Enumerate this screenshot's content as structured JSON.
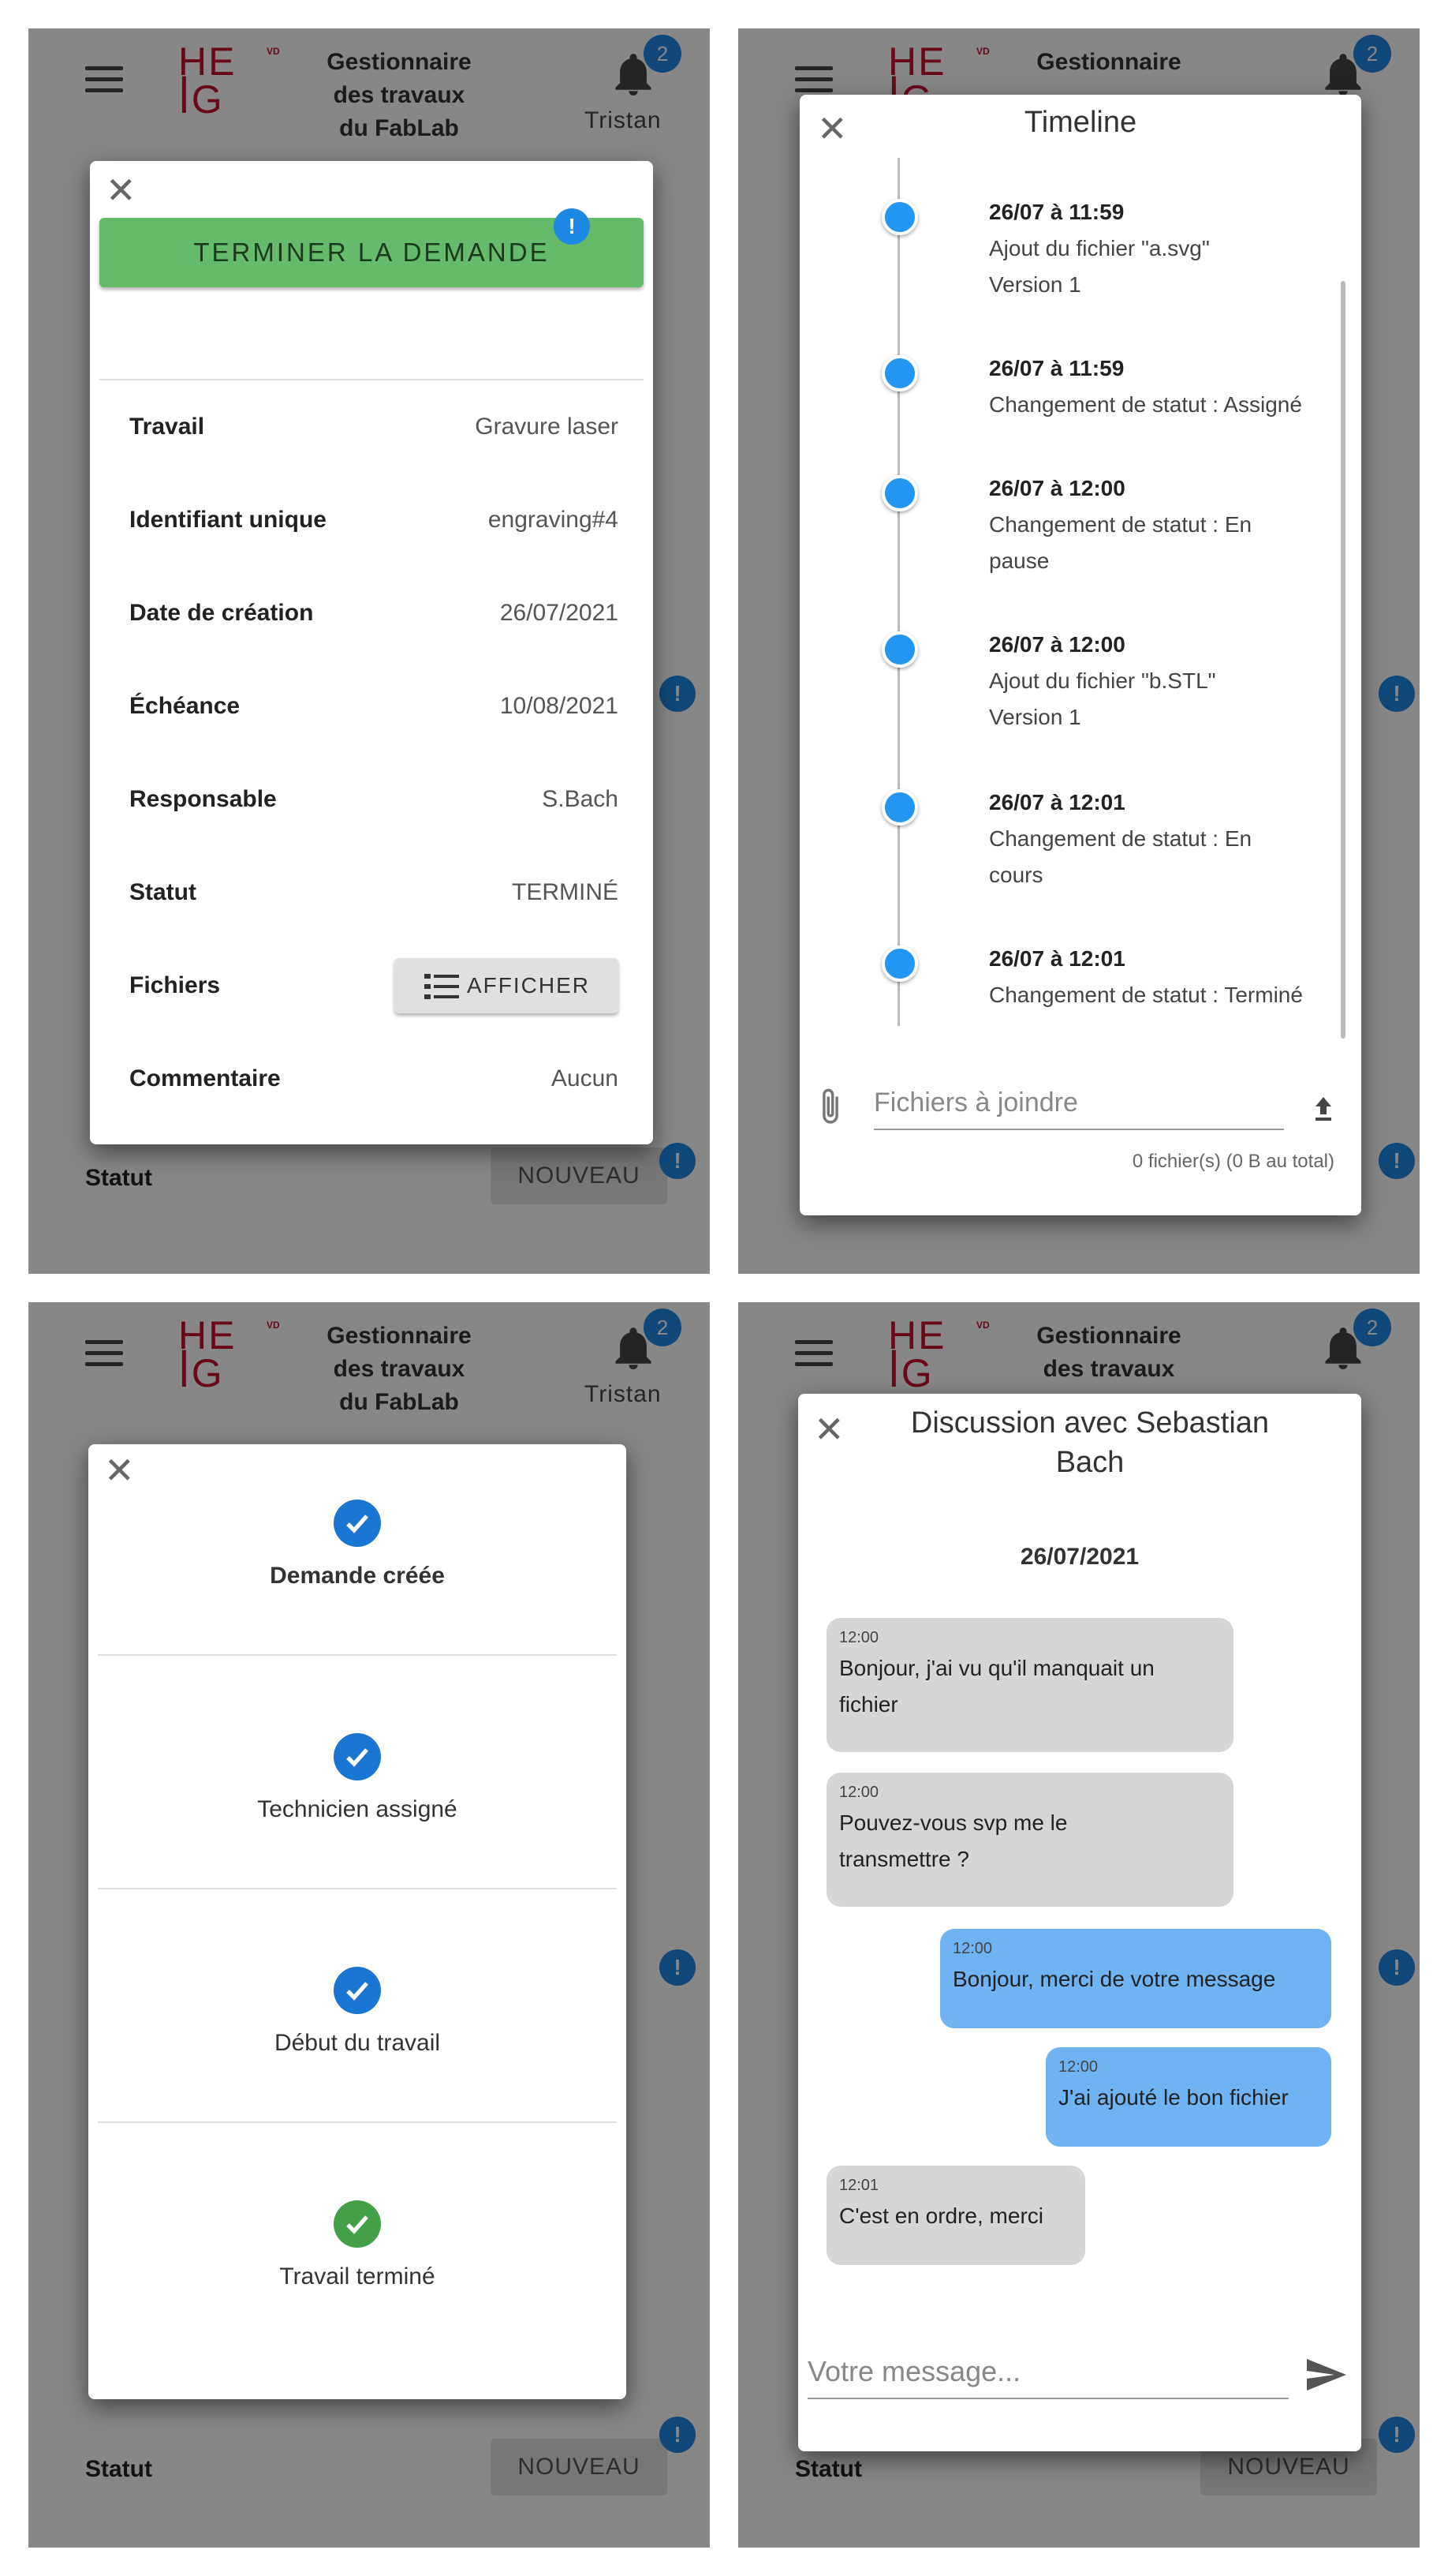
{
  "app": {
    "logo_text": "HE\nIG",
    "logo_suffix": "VD",
    "title": "Gestionnaire des travaux du FabLab",
    "title_lines": [
      "Gestionnaire",
      "des travaux",
      "du FabLab"
    ],
    "notification_count": "2",
    "user": "Tristan",
    "brand_color": "#c8102e",
    "accent_color": "#1e88e5"
  },
  "background_list": {
    "statut_label": "Statut",
    "statut_value": "NOUVEAU"
  },
  "panel_details": {
    "action_button": "TERMINER LA DEMANDE",
    "action_color": "#66bb6a",
    "rows": [
      {
        "label": "Travail",
        "value": "Gravure laser"
      },
      {
        "label": "Identifiant unique",
        "value": "engraving#4"
      },
      {
        "label": "Date de création",
        "value": "26/07/2021"
      },
      {
        "label": "Échéance",
        "value": "10/08/2021"
      },
      {
        "label": "Responsable",
        "value": "S.Bach"
      },
      {
        "label": "Statut",
        "value": "TERMINÉ"
      },
      {
        "label": "Fichiers",
        "value": "AFFICHER"
      },
      {
        "label": "Commentaire",
        "value": "Aucun"
      }
    ]
  },
  "panel_timeline": {
    "title": "Timeline",
    "events": [
      {
        "date": "26/07 à 11:59",
        "lines": [
          "Ajout du fichier \"a.svg\"",
          "Version 1"
        ]
      },
      {
        "date": "26/07 à 11:59",
        "lines": [
          "Changement de statut : Assigné"
        ]
      },
      {
        "date": "26/07 à 12:00",
        "lines": [
          "Changement de statut : En",
          "pause"
        ]
      },
      {
        "date": "26/07 à 12:00",
        "lines": [
          "Ajout du fichier \"b.STL\"",
          "Version 1"
        ]
      },
      {
        "date": "26/07 à 12:01",
        "lines": [
          "Changement de statut : En",
          "cours"
        ]
      },
      {
        "date": "26/07 à 12:01",
        "lines": [
          "Changement de statut : Terminé"
        ]
      }
    ],
    "file_input_placeholder": "Fichiers à joindre",
    "file_count": "0 fichier(s) (0 B au total)"
  },
  "panel_steps": {
    "steps": [
      {
        "label": "Demande créée",
        "icon": "check-circle-icon",
        "color": "#1976d2",
        "bold": true
      },
      {
        "label": "Technicien assigné",
        "icon": "check-circle-icon",
        "color": "#1976d2"
      },
      {
        "label": "Début du travail",
        "icon": "check-circle-icon",
        "color": "#1976d2"
      },
      {
        "label": "Travail terminé",
        "icon": "check-circle-icon",
        "color": "#43a047"
      }
    ]
  },
  "panel_chat": {
    "title": "Discussion avec Sebastian Bach",
    "title_lines": [
      "Discussion avec Sebastian",
      "Bach"
    ],
    "date": "26/07/2021",
    "messages": [
      {
        "time": "12:00",
        "lines": [
          "Bonjour, j'ai vu qu'il manquait un",
          "fichier"
        ],
        "from": "other"
      },
      {
        "time": "12:00",
        "lines": [
          "Pouvez-vous svp me le",
          "transmettre ?"
        ],
        "from": "other"
      },
      {
        "time": "12:00",
        "lines": [
          "Bonjour, merci de votre message"
        ],
        "from": "me"
      },
      {
        "time": "12:00",
        "lines": [
          "J'ai ajouté le bon fichier"
        ],
        "from": "me"
      },
      {
        "time": "12:01",
        "lines": [
          "C'est en ordre, merci"
        ],
        "from": "other"
      }
    ],
    "input_placeholder": "Votre message..."
  }
}
